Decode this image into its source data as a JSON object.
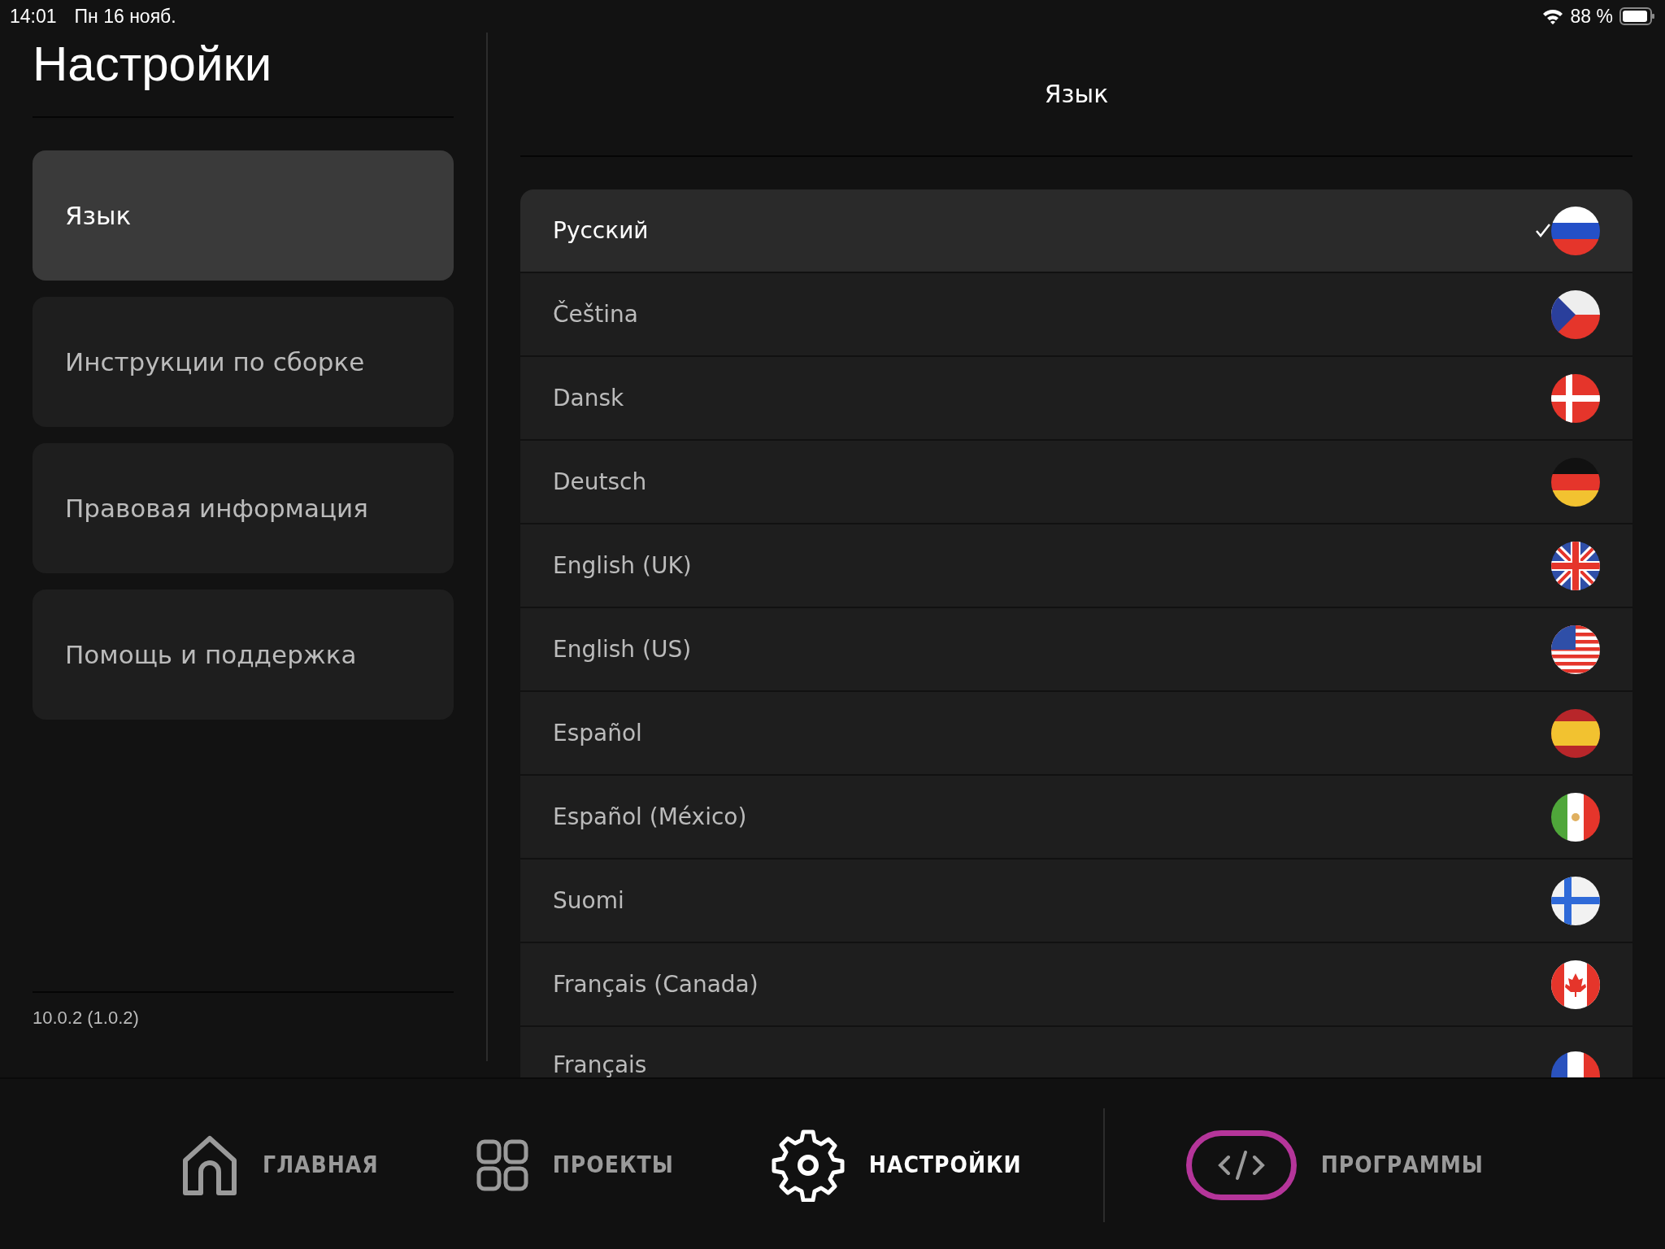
{
  "status_bar": {
    "time": "14:01",
    "date": "Пн 16 нояб.",
    "battery": "88 %"
  },
  "sidebar": {
    "title": "Настройки",
    "items": [
      {
        "label": "Язык",
        "selected": true
      },
      {
        "label": "Инструкции по сборке",
        "selected": false
      },
      {
        "label": "Правовая информация",
        "selected": false
      },
      {
        "label": "Помощь и поддержка",
        "selected": false
      }
    ],
    "version": "10.0.2 (1.0.2)"
  },
  "content": {
    "title": "Язык",
    "languages": [
      {
        "label": "Русский",
        "selected": true
      },
      {
        "label": "Čeština",
        "selected": false
      },
      {
        "label": "Dansk",
        "selected": false
      },
      {
        "label": "Deutsch",
        "selected": false
      },
      {
        "label": "English (UK)",
        "selected": false
      },
      {
        "label": "English (US)",
        "selected": false
      },
      {
        "label": "Español",
        "selected": false
      },
      {
        "label": "Español (México)",
        "selected": false
      },
      {
        "label": "Suomi",
        "selected": false
      },
      {
        "label": "Français (Canada)",
        "selected": false
      },
      {
        "label": "Français",
        "selected": false
      }
    ]
  },
  "nav": {
    "items": [
      {
        "kind": "home",
        "label": "ГЛАВНАЯ",
        "selected": false
      },
      {
        "kind": "projects",
        "label": "ПРОЕКТЫ",
        "selected": false
      },
      {
        "kind": "settings",
        "label": "НАСТРОЙКИ",
        "selected": true
      }
    ],
    "programs": {
      "label": "ПРОГРАММЫ"
    }
  }
}
